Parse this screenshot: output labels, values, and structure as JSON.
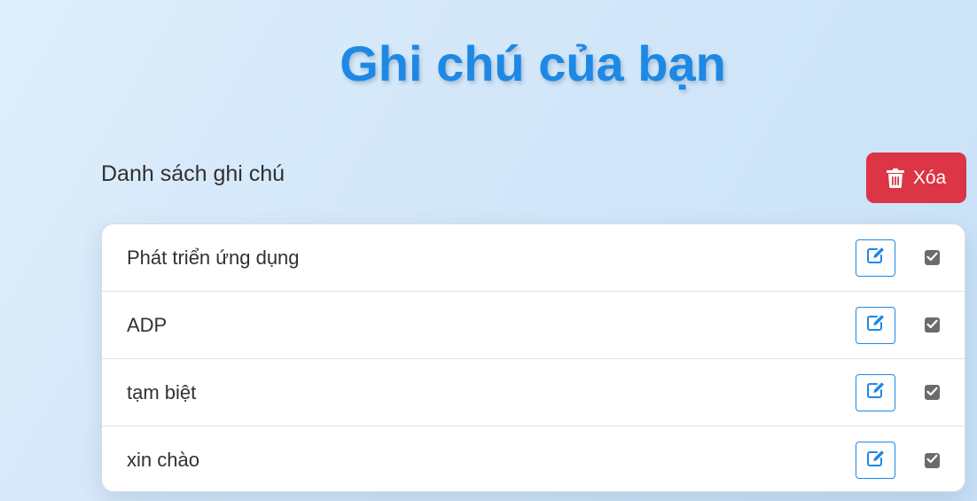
{
  "header": {
    "title": "Ghi chú của bạn"
  },
  "list": {
    "heading": "Danh sách ghi chú",
    "delete_label": "Xóa",
    "delete_icon": "trash-icon",
    "items": [
      {
        "text": "Phát triển ứng dụng",
        "checked": true
      },
      {
        "text": "ADP",
        "checked": true
      },
      {
        "text": "tạm biệt",
        "checked": true
      },
      {
        "text": "xin chào",
        "checked": true
      }
    ]
  },
  "icons": {
    "edit": "edit-icon",
    "checkbox": "checkbox-checked-icon"
  },
  "colors": {
    "accent": "#1e88e5",
    "danger": "#dc3545",
    "text": "#2f3133",
    "checkbox": "#6b6b6b"
  }
}
